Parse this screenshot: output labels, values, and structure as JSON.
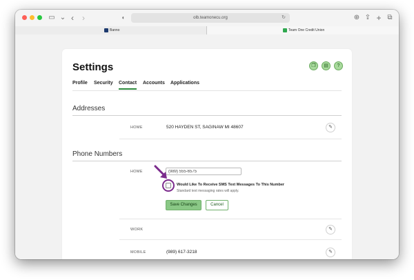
{
  "browser": {
    "url": "olb.teamonecu.org",
    "tabs": [
      {
        "label": "Banno"
      },
      {
        "label": "Team One Credit Union"
      }
    ]
  },
  "page": {
    "title": "Settings",
    "header_icons": [
      "copy-icon",
      "document-icon",
      "help-icon"
    ],
    "tabs": [
      {
        "label": "Profile"
      },
      {
        "label": "Security"
      },
      {
        "label": "Contact",
        "active": true
      },
      {
        "label": "Accounts"
      },
      {
        "label": "Applications"
      }
    ],
    "addresses": {
      "title": "Addresses",
      "rows": [
        {
          "label": "HOME",
          "value": "520 HAYDEN ST, SAGINAW MI 48607"
        }
      ]
    },
    "phone_numbers": {
      "title": "Phone Numbers",
      "home_label": "HOME",
      "home_value": "(989) 555-6575",
      "sms_label": "Would Like To Receive SMS Text Messages To This Number",
      "sms_note": "Standard text messaging rates will apply.",
      "save_label": "Save Changes",
      "cancel_label": "Cancel",
      "rows": [
        {
          "label": "WORK",
          "value": ""
        },
        {
          "label": "MOBILE",
          "value": "(989) 617-3218"
        }
      ]
    }
  },
  "colors": {
    "accent": "#2e8b3e",
    "button_green": "#8ac886",
    "highlight": "#7b2a8c"
  }
}
